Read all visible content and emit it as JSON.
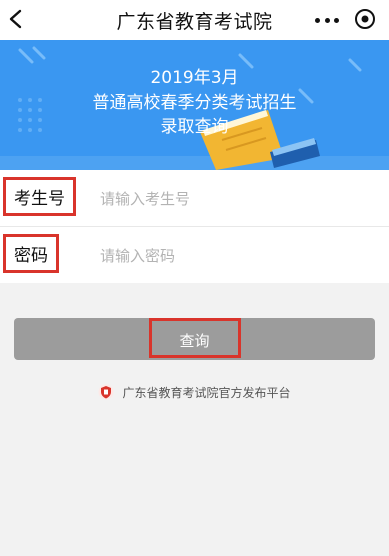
{
  "nav": {
    "title": "广东省教育考试院"
  },
  "banner": {
    "line1": "2019年3月",
    "line2": "普通高校春季分类考试招生",
    "line3": "录取查询"
  },
  "form": {
    "exam_number": {
      "label": "考生号",
      "placeholder": "请输入考生号"
    },
    "password": {
      "label": "密码",
      "placeholder": "请输入密码"
    }
  },
  "query_button": {
    "label": "查询"
  },
  "footer": {
    "text": "广东省教育考试院官方发布平台"
  },
  "colors": {
    "banner": "#3a97f1",
    "button": "#9c9c9c",
    "highlight": "#d9342b"
  }
}
